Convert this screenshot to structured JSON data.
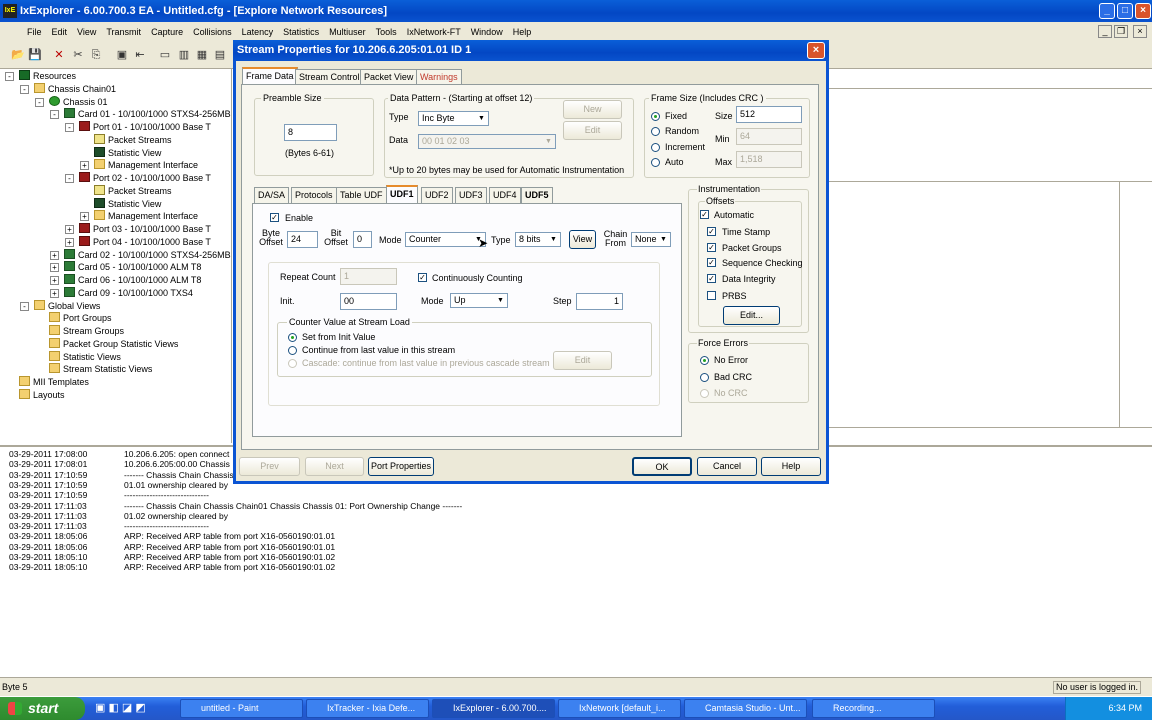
{
  "app": {
    "title": "IxExplorer - 6.00.700.3 EA - Untitled.cfg - [Explore Network Resources]",
    "icon_label": "IxE",
    "menu": [
      "File",
      "Edit",
      "View",
      "Transmit",
      "Capture",
      "Collisions",
      "Latency",
      "Statistics",
      "Multiuser",
      "Tools",
      "IxNetwork-FT",
      "Window",
      "Help"
    ]
  },
  "tree": {
    "items": [
      {
        "label": "Resources",
        "icon": "resources-icon"
      },
      {
        "label": "Chassis Chain01",
        "icon": "folder-icon"
      },
      {
        "label": "Chassis 01",
        "icon": "chassis-icon"
      },
      {
        "label": "Card 01 - 10/100/1000 STXS4-256MB",
        "icon": "card-icon"
      },
      {
        "label": "Port 01  - 10/100/1000 Base T",
        "icon": "port-icon"
      },
      {
        "label": "Packet Streams",
        "icon": "packet-streams-icon"
      },
      {
        "label": "Statistic View",
        "icon": "statistic-view-icon"
      },
      {
        "label": "Management Interface",
        "icon": "folder-icon"
      },
      {
        "label": "Port 02  - 10/100/1000 Base T",
        "icon": "port-icon"
      },
      {
        "label": "Packet Streams",
        "icon": "packet-streams-icon"
      },
      {
        "label": "Statistic View",
        "icon": "statistic-view-icon"
      },
      {
        "label": "Management Interface",
        "icon": "folder-icon"
      },
      {
        "label": "Port 03  - 10/100/1000 Base T",
        "icon": "port-icon"
      },
      {
        "label": "Port 04  - 10/100/1000 Base T",
        "icon": "port-icon"
      },
      {
        "label": "Card 02 - 10/100/1000 STXS4-256MB",
        "icon": "card-icon"
      },
      {
        "label": "Card 05 - 10/100/1000 ALM T8",
        "icon": "card-icon"
      },
      {
        "label": "Card 06 - 10/100/1000 ALM T8",
        "icon": "card-icon"
      },
      {
        "label": "Card 09 - 10/100/1000 TXS4",
        "icon": "card-icon"
      },
      {
        "label": "Global Views",
        "icon": "folder-icon"
      },
      {
        "label": "Port Groups",
        "icon": "folder-icon"
      },
      {
        "label": "Stream Groups",
        "icon": "folder-icon"
      },
      {
        "label": "Packet Group Statistic Views",
        "icon": "folder-icon"
      },
      {
        "label": "Statistic Views",
        "icon": "folder-icon"
      },
      {
        "label": "Stream Statistic Views",
        "icon": "folder-icon"
      },
      {
        "label": "MII Templates",
        "icon": "folder-icon"
      },
      {
        "label": "Layouts",
        "icon": "folder-icon"
      }
    ]
  },
  "log": {
    "rows": [
      {
        "time": "03-29-2011 17:08:00",
        "msg": "10.206.6.205: open connect"
      },
      {
        "time": "03-29-2011 17:08:01",
        "msg": "10.206.6.205:00.00 Chassis"
      },
      {
        "time": "03-29-2011 17:10:59",
        "msg": "-------     Chassis Chain Chassis"
      },
      {
        "time": "03-29-2011 17:10:59",
        "msg": "01.01 ownership cleared by"
      },
      {
        "time": "03-29-2011 17:10:59",
        "msg": "------------------------------"
      },
      {
        "time": "03-29-2011 17:11:03",
        "msg": "-------     Chassis Chain Chassis Chain01 Chassis Chassis 01: Port Ownership Change     -------"
      },
      {
        "time": "03-29-2011 17:11:03",
        "msg": "01.02 ownership cleared by"
      },
      {
        "time": "03-29-2011 17:11:03",
        "msg": "------------------------------"
      },
      {
        "time": "03-29-2011 18:05:06",
        "msg": "ARP: Received ARP table from port X16-0560190:01.01"
      },
      {
        "time": "03-29-2011 18:05:06",
        "msg": "ARP: Received ARP table from port X16-0560190:01.01"
      },
      {
        "time": "03-29-2011 18:05:10",
        "msg": "ARP: Received ARP table from port X16-0560190:01.02"
      },
      {
        "time": "03-29-2011 18:05:10",
        "msg": "ARP: Received ARP table from port X16-0560190:01.02"
      }
    ]
  },
  "status": {
    "left": "Byte 5",
    "right": "No user is logged in."
  },
  "taskbar": {
    "start": "start",
    "tasks": [
      "untitled - Paint",
      "IxTracker - Ixia Defe...",
      "IxExplorer - 6.00.700....",
      "IxNetwork [default_i...",
      "Camtasia Studio - Unt...",
      "Recording..."
    ],
    "clock": "6:34 PM"
  },
  "dialog": {
    "title": "Stream Properties for 10.206.6.205:01.01  ID 1",
    "tabs": [
      "Frame Data",
      "Stream Control",
      "Packet View",
      "Warnings"
    ],
    "preamble": {
      "title": "Preamble Size",
      "value": "8",
      "hint": "(Bytes 6-61)"
    },
    "pattern": {
      "title": "Data Pattern - (Starting at offset 12)",
      "type_label": "Type",
      "type_value": "Inc Byte",
      "data_label": "Data",
      "data_value": "00 01 02 03",
      "new": "New",
      "edit": "Edit",
      "note": "*Up to 20 bytes may be used for Automatic Instrumentation"
    },
    "frame": {
      "title": "Frame Size  (Includes CRC )",
      "options": [
        "Fixed",
        "Random",
        "Increment",
        "Auto"
      ],
      "size_label": "Size",
      "size_value": "512",
      "min_label": "Min",
      "min_value": "64",
      "max_label": "Max",
      "max_value": "1,518"
    },
    "subtabs": [
      "DA/SA",
      "Protocols",
      "Table UDF",
      "UDF1",
      "UDF2",
      "UDF3",
      "UDF4",
      "UDF5"
    ],
    "udf": {
      "enable": "Enable",
      "byte_offset_label": "Byte Offset",
      "byte_offset": "24",
      "bit_offset_label": "Bit Offset",
      "bit_offset": "0",
      "mode_label": "Mode",
      "mode_value": "Counter",
      "type_label": "Type",
      "type_value": "8 bits",
      "view": "View",
      "chain_label": "Chain From",
      "chain_value": "None",
      "repeat_label": "Repeat Count",
      "repeat_value": "1",
      "continuous": "Continuously Counting",
      "init_label": "Init.",
      "init_value": "00",
      "mode2_label": "Mode",
      "mode2_value": "Up",
      "step_label": "Step",
      "step_value": "1",
      "counter_title": "Counter Value at Stream Load",
      "counter_opts": [
        "Set from Init Value",
        "Continue from last value in this stream",
        "Cascade: continue from last value in previous cascade stream"
      ],
      "edit": "Edit"
    },
    "instr": {
      "title": "Instrumentation",
      "offsets": "Offsets",
      "automatic": "Automatic",
      "items": [
        "Time Stamp",
        "Packet Groups",
        "Sequence Checking",
        "Data Integrity",
        "PRBS"
      ],
      "edit": "Edit..."
    },
    "force": {
      "title": "Force Errors",
      "options": [
        "No Error",
        "Bad CRC",
        "No CRC"
      ]
    },
    "buttons": {
      "prev": "Prev",
      "next": "Next",
      "port_props": "Port Properties",
      "ok": "OK",
      "cancel": "Cancel",
      "help": "Help"
    }
  }
}
